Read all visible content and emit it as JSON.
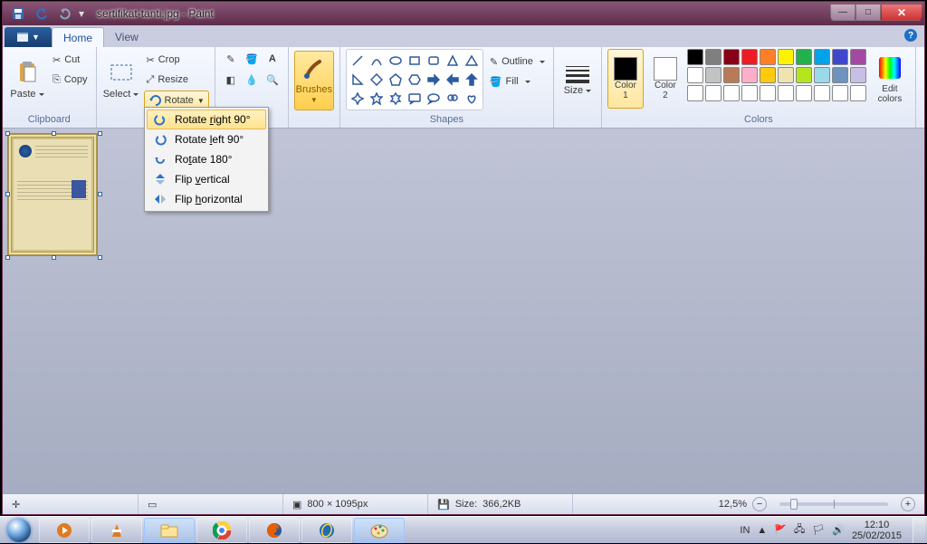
{
  "title": "sertifikat-tanti.jpg - Paint",
  "window_controls": {
    "minimize": "—",
    "maximize": "□",
    "close": "✕"
  },
  "tabs": {
    "file": "",
    "home": "Home",
    "view": "View"
  },
  "ribbon": {
    "clipboard": {
      "label": "Clipboard",
      "paste": "Paste",
      "cut": "Cut",
      "copy": "Copy"
    },
    "image": {
      "select": "Select",
      "crop": "Crop",
      "resize": "Resize",
      "rotate": "Rotate"
    },
    "tools": {
      "label": ""
    },
    "brushes": "Brushes",
    "shapes": {
      "label": "Shapes",
      "outline": "Outline",
      "fill": "Fill"
    },
    "size": "Size",
    "colors": {
      "label": "Colors",
      "color1": "Color\n1",
      "color2": "Color\n2",
      "edit": "Edit\ncolors",
      "current1": "#000000",
      "current2": "#ffffff",
      "row1": [
        "#000000",
        "#7f7f7f",
        "#880015",
        "#ed1c24",
        "#ff7f27",
        "#fff200",
        "#22b14c",
        "#00a2e8",
        "#3f48cc",
        "#a349a4"
      ],
      "row2": [
        "#ffffff",
        "#c3c3c3",
        "#b97a57",
        "#ffaec9",
        "#ffc90e",
        "#efe4b0",
        "#b5e61d",
        "#99d9ea",
        "#7092be",
        "#c8bfe7"
      ],
      "row3": [
        "#ffffff",
        "#ffffff",
        "#ffffff",
        "#ffffff",
        "#ffffff",
        "#ffffff",
        "#ffffff",
        "#ffffff",
        "#ffffff",
        "#ffffff"
      ]
    }
  },
  "rotate_menu": {
    "right90": "Rotate right 90°",
    "left90": "Rotate left 90°",
    "r180": "Rotate 180°",
    "flipv": "Flip vertical",
    "fliph": "Flip horizontal"
  },
  "statusbar": {
    "dimensions": "800 × 1095px",
    "size_label": "Size:",
    "size_value": "366,2KB",
    "zoom": "12,5%"
  },
  "taskbar": {
    "lang": "IN",
    "time": "12:10",
    "date": "25/02/2015"
  }
}
